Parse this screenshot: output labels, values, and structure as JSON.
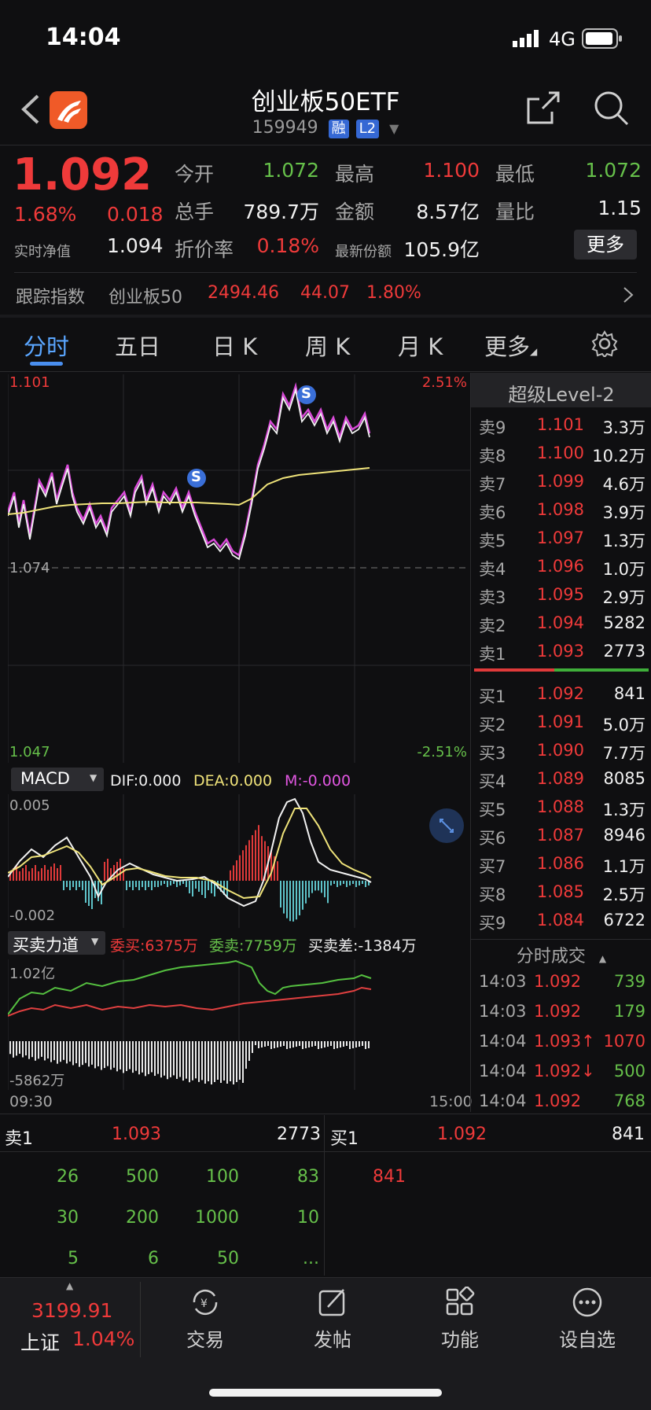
{
  "status_bar": {
    "time": "14:04",
    "network": "4G"
  },
  "header": {
    "title": "创业板50ETF",
    "code": "159949",
    "badges": [
      "融",
      "L2"
    ]
  },
  "quote": {
    "price": "1.092",
    "change_pct": "1.68%",
    "change": "0.018",
    "nav_label": "实时净值",
    "nav_value": "1.094",
    "fields": [
      {
        "label": "今开",
        "value": "1.072",
        "color": "green"
      },
      {
        "label": "最高",
        "value": "1.100",
        "color": "red"
      },
      {
        "label": "最低",
        "value": "1.072",
        "color": "green"
      },
      {
        "label": "总手",
        "value": "789.7万",
        "color": "white"
      },
      {
        "label": "金额",
        "value": "8.57亿",
        "color": "white"
      },
      {
        "label": "量比",
        "value": "1.15",
        "color": "white"
      },
      {
        "label": "折价率",
        "value": "0.18%",
        "color": "red"
      },
      {
        "label": "最新份额",
        "value": "105.9亿",
        "color": "white"
      }
    ],
    "more_button": "更多"
  },
  "tracking": {
    "label": "跟踪指数",
    "index_name": "创业板50",
    "index_value": "2494.46",
    "index_change": "44.07",
    "index_pct": "1.80%"
  },
  "tabs": [
    "分时",
    "五日",
    "日 K",
    "周 K",
    "月 K",
    "更多"
  ],
  "intraday": {
    "y_top": "1.101",
    "y_top_pct": "2.51%",
    "y_mid": "1.074",
    "y_bottom": "1.047",
    "y_bottom_pct": "-2.51%",
    "marker_label": "S",
    "time_start": "09:30",
    "time_end": "15:00"
  },
  "macd": {
    "label": "MACD",
    "dif": "DIF:0.000",
    "dea": "DEA:0.000",
    "m": "M:-0.000",
    "y_top": "0.005",
    "y_bottom": "-0.002"
  },
  "force": {
    "label": "买卖力道",
    "buy": "委买:6375万",
    "sell": "委卖:7759万",
    "diff": "买卖差:-1384万",
    "y_top": "1.02亿",
    "y_bottom": "-5862万"
  },
  "level2": {
    "title": "超级Level-2",
    "asks": [
      {
        "label": "卖9",
        "price": "1.101",
        "vol": "3.3万"
      },
      {
        "label": "卖8",
        "price": "1.100",
        "vol": "10.2万"
      },
      {
        "label": "卖7",
        "price": "1.099",
        "vol": "4.6万"
      },
      {
        "label": "卖6",
        "price": "1.098",
        "vol": "3.9万"
      },
      {
        "label": "卖5",
        "price": "1.097",
        "vol": "1.3万"
      },
      {
        "label": "卖4",
        "price": "1.096",
        "vol": "1.0万"
      },
      {
        "label": "卖3",
        "price": "1.095",
        "vol": "2.9万"
      },
      {
        "label": "卖2",
        "price": "1.094",
        "vol": "5282"
      },
      {
        "label": "卖1",
        "price": "1.093",
        "vol": "2773"
      }
    ],
    "bids": [
      {
        "label": "买1",
        "price": "1.092",
        "vol": "841"
      },
      {
        "label": "买2",
        "price": "1.091",
        "vol": "5.0万"
      },
      {
        "label": "买3",
        "price": "1.090",
        "vol": "7.7万"
      },
      {
        "label": "买4",
        "price": "1.089",
        "vol": "8085"
      },
      {
        "label": "买5",
        "price": "1.088",
        "vol": "1.3万"
      },
      {
        "label": "买6",
        "price": "1.087",
        "vol": "8946"
      },
      {
        "label": "买7",
        "price": "1.086",
        "vol": "1.1万"
      },
      {
        "label": "买8",
        "price": "1.085",
        "vol": "2.5万"
      },
      {
        "label": "买9",
        "price": "1.084",
        "vol": "6722"
      }
    ],
    "trades_title": "分时成交",
    "trades": [
      {
        "time": "14:03",
        "price": "1.092",
        "vol": "739",
        "vol_color": "green",
        "price_arrow": ""
      },
      {
        "time": "14:03",
        "price": "1.092",
        "vol": "179",
        "vol_color": "green",
        "price_arrow": ""
      },
      {
        "time": "14:04",
        "price": "1.093↑",
        "vol": "1070",
        "vol_color": "red",
        "price_arrow": "up"
      },
      {
        "time": "14:04",
        "price": "1.092↓",
        "vol": "500",
        "vol_color": "green",
        "price_arrow": "down"
      },
      {
        "time": "14:04",
        "price": "1.092",
        "vol": "768",
        "vol_color": "green",
        "price_arrow": ""
      }
    ]
  },
  "queue": {
    "sell_label": "卖1",
    "sell_price": "1.093",
    "sell_vol": "2773",
    "buy_label": "买1",
    "buy_price": "1.092",
    "buy_vol": "841",
    "sell_orders": [
      [
        "26",
        "500",
        "100",
        "83"
      ],
      [
        "30",
        "200",
        "1000",
        "10"
      ],
      [
        "5",
        "6",
        "50",
        "..."
      ]
    ],
    "buy_orders": [
      "841"
    ]
  },
  "bottom_nav": {
    "index_value": "3199.91",
    "index_name": "上证",
    "index_pct": "1.04%",
    "items": [
      "交易",
      "发帖",
      "功能",
      "设自选"
    ]
  }
}
